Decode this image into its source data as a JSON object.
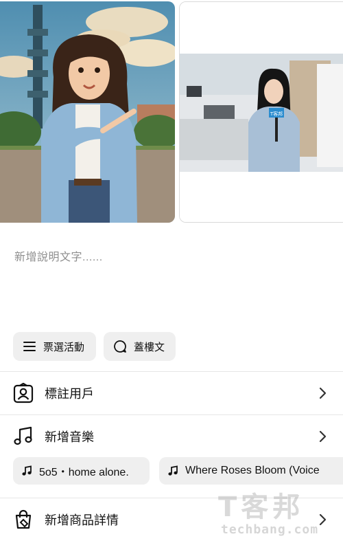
{
  "photos": [
    {
      "kind": "illustration"
    },
    {
      "kind": "photo",
      "sign_text": "T客邦"
    }
  ],
  "composer": {
    "caption_placeholder": "新增說明文字......"
  },
  "actions": {
    "poll_label": "票選活動",
    "thread_label": "蓋樓文"
  },
  "rows": {
    "tag_people": "標註用戶",
    "add_music": "新增音樂",
    "add_product": "新增商品詳情"
  },
  "music_suggestions": [
    {
      "title": "5o5・home alone."
    },
    {
      "title": "Where Roses Bloom (Voice"
    }
  ],
  "watermark": {
    "brand": "T客邦",
    "domain": "techbang.com"
  }
}
